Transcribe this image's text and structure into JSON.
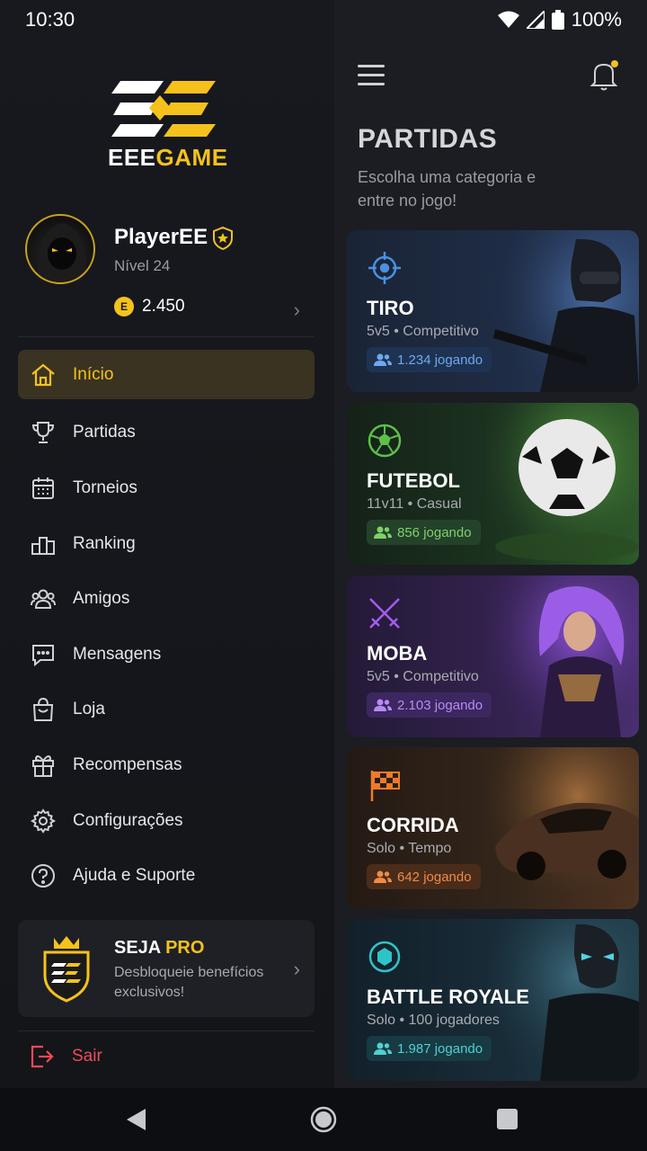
{
  "status_bar": {
    "time": "10:30",
    "battery": "100%"
  },
  "logo": {
    "text_white": "EEE",
    "text_yellow": "GAME"
  },
  "profile": {
    "username": "PlayerEE",
    "level": "Nível 24",
    "coins": "2.450"
  },
  "menu": [
    {
      "label": "Início",
      "icon": "home-icon",
      "active": true
    },
    {
      "label": "Partidas",
      "icon": "trophy-icon",
      "active": false
    },
    {
      "label": "Torneios",
      "icon": "calendar-icon",
      "active": false
    },
    {
      "label": "Ranking",
      "icon": "podium-icon",
      "active": false
    },
    {
      "label": "Amigos",
      "icon": "friends-icon",
      "active": false
    },
    {
      "label": "Mensagens",
      "icon": "chat-icon",
      "active": false
    },
    {
      "label": "Loja",
      "icon": "shopping-bag-icon",
      "active": false
    },
    {
      "label": "Recompensas",
      "icon": "gift-icon",
      "active": false
    },
    {
      "label": "Configurações",
      "icon": "gear-icon",
      "active": false
    },
    {
      "label": "Ajuda e Suporte",
      "icon": "help-icon",
      "active": false
    }
  ],
  "pro": {
    "title_white": "SEJA",
    "title_yellow": "PRO",
    "description": "Desbloqueie benefícios exclusivos!"
  },
  "logout": {
    "label": "Sair"
  },
  "main": {
    "title": "PARTIDAS",
    "subtitle": "Escolha uma categoria e entre no jogo!",
    "categories": [
      {
        "title": "TIRO",
        "subtitle": "5v5 • Competitivo",
        "players": "1.234 jogando",
        "icon": "crosshair-icon",
        "accent": "#4a90e2"
      },
      {
        "title": "FUTEBOL",
        "subtitle": "11v11 • Casual",
        "players": "856 jogando",
        "icon": "soccer-ball-icon",
        "accent": "#5cc149"
      },
      {
        "title": "MOBA",
        "subtitle": "5v5 • Competitivo",
        "players": "2.103 jogando",
        "icon": "crossed-swords-icon",
        "accent": "#a35cf0"
      },
      {
        "title": "CORRIDA",
        "subtitle": "Solo • Tempo",
        "players": "642 jogando",
        "icon": "checkered-flag-icon",
        "accent": "#f07a2a"
      },
      {
        "title": "BATTLE ROYALE",
        "subtitle": "Solo • 100 jogadores",
        "players": "1.987 jogando",
        "icon": "target-zone-icon",
        "accent": "#2ec4c7"
      }
    ]
  },
  "colors": {
    "brand_yellow": "#f5c21b",
    "logout_red": "#ec4b5a"
  }
}
